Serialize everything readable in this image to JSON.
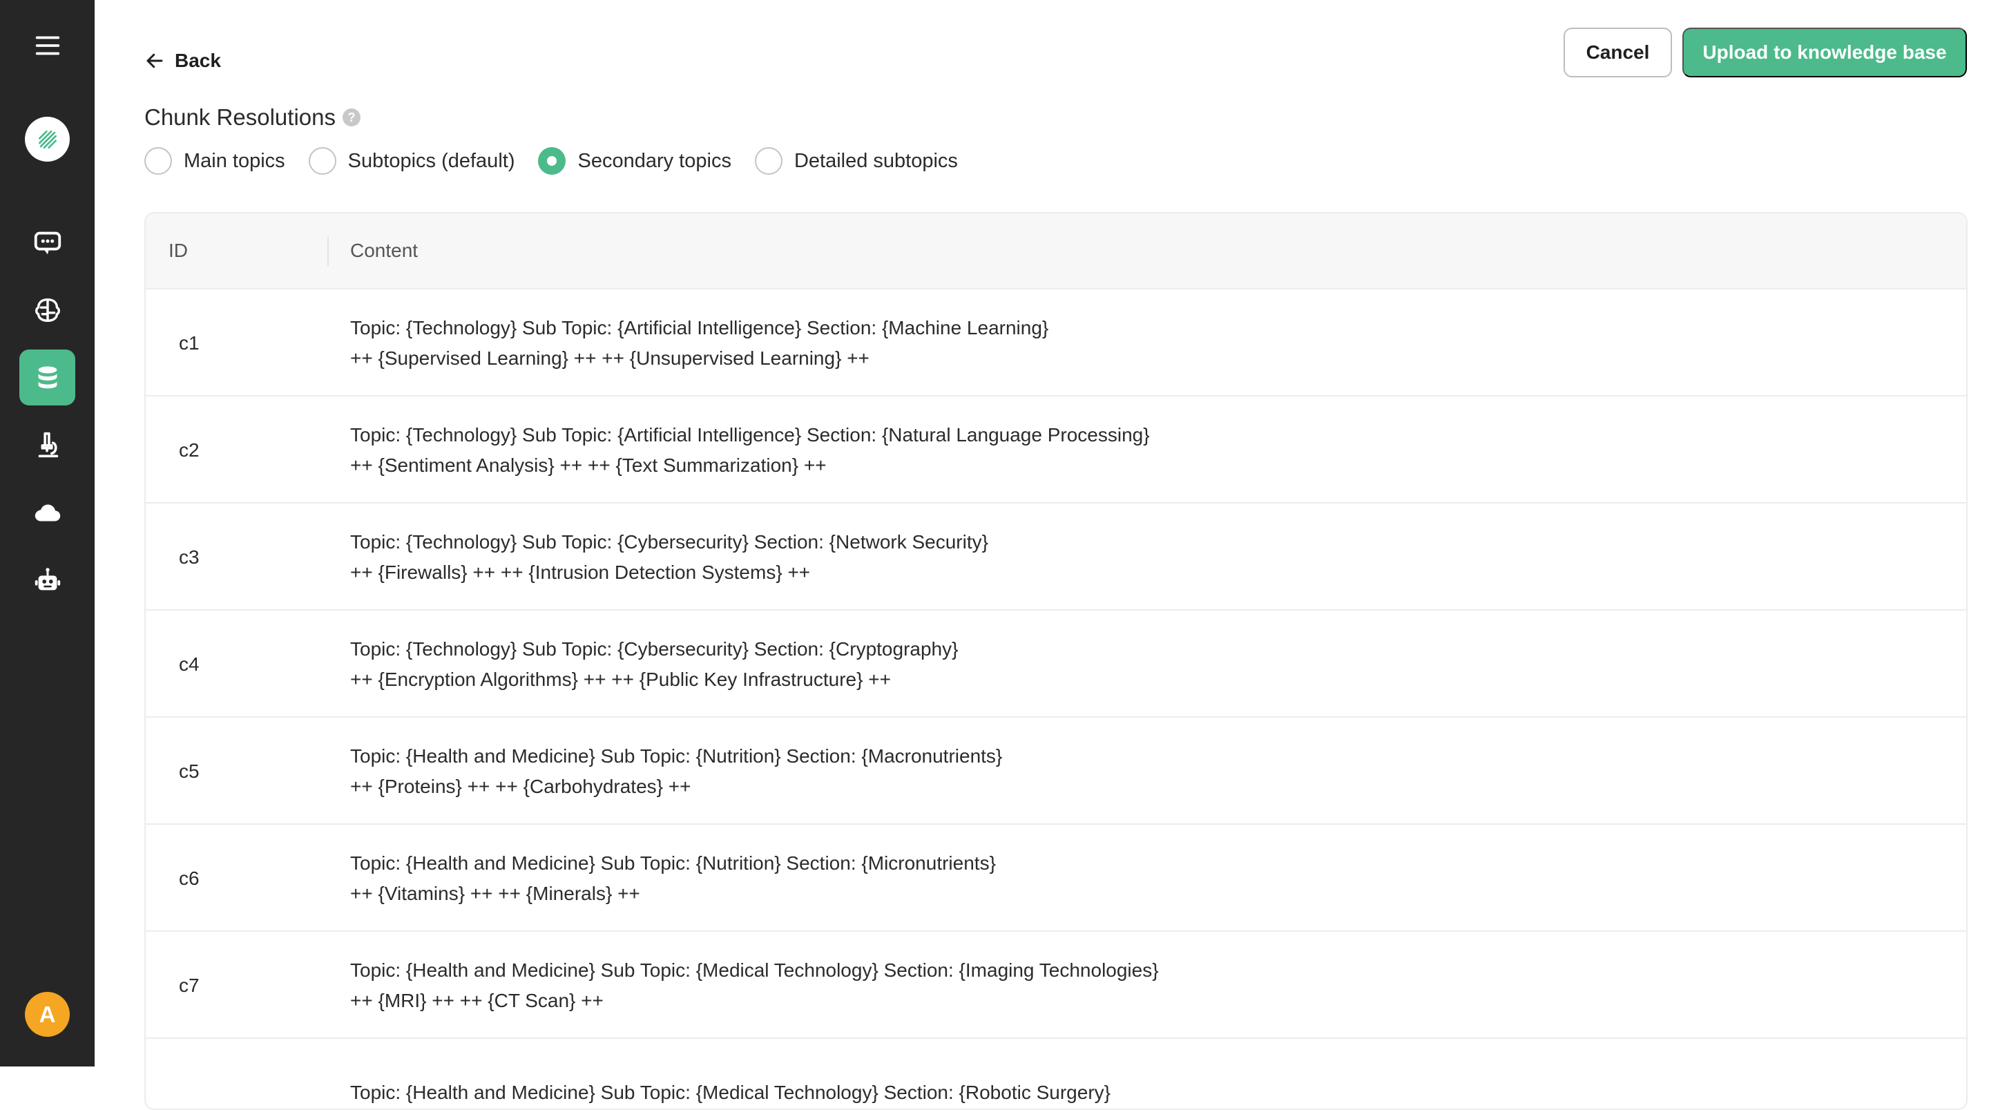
{
  "sidebar": {
    "menu_icon": "hamburger-menu-icon",
    "logo_icon": "app-logo-icon",
    "items": [
      {
        "icon": "chat-icon",
        "active": false
      },
      {
        "icon": "brain-icon",
        "active": false
      },
      {
        "icon": "database-icon",
        "active": true
      },
      {
        "icon": "microscope-icon",
        "active": false
      },
      {
        "icon": "cloud-icon",
        "active": false
      },
      {
        "icon": "robot-icon",
        "active": false
      }
    ],
    "avatar_initial": "A"
  },
  "header": {
    "back_label": "Back",
    "cancel_label": "Cancel",
    "upload_label": "Upload to knowledge base"
  },
  "chunk": {
    "title": "Chunk Resolutions",
    "help_glyph": "?",
    "options": [
      {
        "label": "Main topics",
        "checked": false
      },
      {
        "label": "Subtopics (default)",
        "checked": false
      },
      {
        "label": "Secondary topics",
        "checked": true
      },
      {
        "label": "Detailed subtopics",
        "checked": false
      }
    ]
  },
  "table": {
    "headers": {
      "id": "ID",
      "content": "Content"
    },
    "rows": [
      {
        "id": "c1",
        "line1": "Topic: {Technology} Sub Topic: {Artificial Intelligence} Section: {Machine Learning}",
        "line2": "++ {Supervised Learning} ++ ++ {Unsupervised Learning} ++"
      },
      {
        "id": "c2",
        "line1": "Topic: {Technology} Sub Topic: {Artificial Intelligence} Section: {Natural Language Processing}",
        "line2": "++ {Sentiment Analysis} ++ ++ {Text Summarization} ++"
      },
      {
        "id": "c3",
        "line1": "Topic: {Technology} Sub Topic: {Cybersecurity} Section: {Network Security}",
        "line2": "++ {Firewalls} ++ ++ {Intrusion Detection Systems} ++"
      },
      {
        "id": "c4",
        "line1": "Topic: {Technology} Sub Topic: {Cybersecurity} Section: {Cryptography}",
        "line2": "++ {Encryption Algorithms} ++ ++ {Public Key Infrastructure} ++"
      },
      {
        "id": "c5",
        "line1": "Topic: {Health and Medicine} Sub Topic: {Nutrition} Section: {Macronutrients}",
        "line2": "++ {Proteins} ++ ++ {Carbohydrates} ++"
      },
      {
        "id": "c6",
        "line1": "Topic: {Health and Medicine} Sub Topic: {Nutrition} Section: {Micronutrients}",
        "line2": "++ {Vitamins} ++ ++ {Minerals} ++"
      },
      {
        "id": "c7",
        "line1": "Topic: {Health and Medicine} Sub Topic: {Medical Technology} Section: {Imaging Technologies}",
        "line2": "++ {MRI} ++ ++ {CT Scan} ++"
      },
      {
        "id": "",
        "line1": "Topic: {Health and Medicine} Sub Topic: {Medical Technology} Section: {Robotic Surgery}",
        "line2": ""
      }
    ]
  },
  "colors": {
    "sidebar_bg": "#262626",
    "accent": "#4cba8b",
    "avatar": "#f5a623"
  }
}
